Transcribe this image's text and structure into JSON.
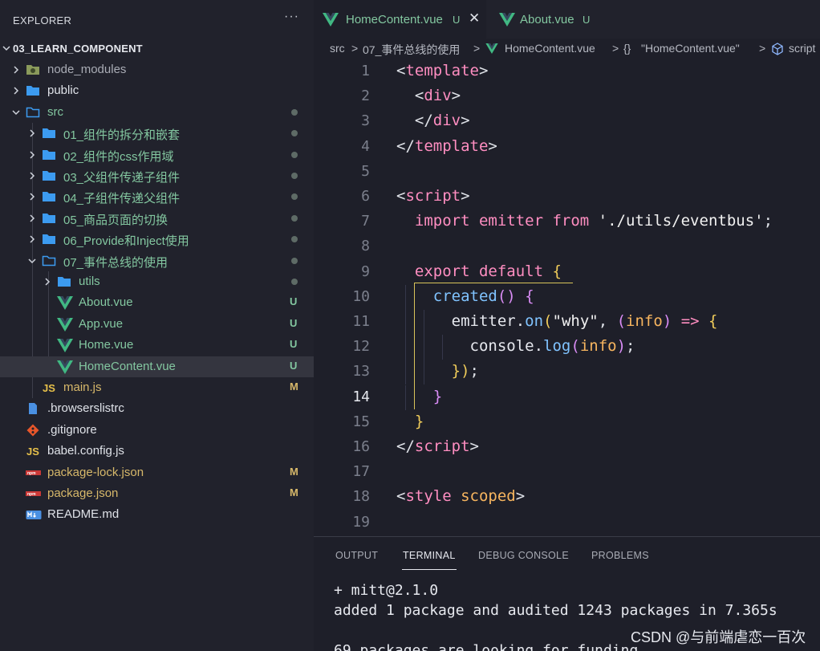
{
  "explorer": {
    "title": "EXPLORER",
    "more": "···",
    "project": "03_LEARN_COMPONENT"
  },
  "tree": [
    {
      "label": "node_modules",
      "icon": "node-modules-folder-icon",
      "indent": 0,
      "chevron": "right",
      "color": "dim"
    },
    {
      "label": "public",
      "icon": "folder-icon",
      "indent": 0,
      "chevron": "right",
      "color": "white"
    },
    {
      "label": "src",
      "icon": "folder-open-icon",
      "indent": 0,
      "chevron": "down",
      "color": "green",
      "dot": true
    },
    {
      "label": "01_组件的拆分和嵌套",
      "icon": "folder-icon",
      "indent": 1,
      "chevron": "right",
      "color": "green",
      "dot": true
    },
    {
      "label": "02_组件的css作用域",
      "icon": "folder-icon",
      "indent": 1,
      "chevron": "right",
      "color": "green",
      "dot": true
    },
    {
      "label": "03_父组件传递子组件",
      "icon": "folder-icon",
      "indent": 1,
      "chevron": "right",
      "color": "green",
      "dot": true
    },
    {
      "label": "04_子组件传递父组件",
      "icon": "folder-icon",
      "indent": 1,
      "chevron": "right",
      "color": "green",
      "dot": true
    },
    {
      "label": "05_商品页面的切换",
      "icon": "folder-icon",
      "indent": 1,
      "chevron": "right",
      "color": "green",
      "dot": true
    },
    {
      "label": "06_Provide和Inject使用",
      "icon": "folder-icon",
      "indent": 1,
      "chevron": "right",
      "color": "green",
      "dot": true
    },
    {
      "label": "07_事件总线的使用",
      "icon": "folder-open-icon",
      "indent": 1,
      "chevron": "down",
      "color": "green",
      "dot": true
    },
    {
      "label": "utils",
      "icon": "folder-icon",
      "indent": 2,
      "chevron": "right",
      "color": "green",
      "dot": true
    },
    {
      "label": "About.vue",
      "icon": "vue-icon",
      "indent": 2,
      "color": "green",
      "badge": "U"
    },
    {
      "label": "App.vue",
      "icon": "vue-icon",
      "indent": 2,
      "color": "green",
      "badge": "U"
    },
    {
      "label": "Home.vue",
      "icon": "vue-icon",
      "indent": 2,
      "color": "green",
      "badge": "U"
    },
    {
      "label": "HomeContent.vue",
      "icon": "vue-icon",
      "indent": 2,
      "color": "green",
      "badge": "U",
      "selected": true
    },
    {
      "label": "main.js",
      "icon": "js-icon",
      "indent": 1,
      "color": "yellow",
      "badge": "M"
    },
    {
      "label": ".browserslistrc",
      "icon": "file-icon",
      "indent": 0,
      "color": "white"
    },
    {
      "label": ".gitignore",
      "icon": "git-icon",
      "indent": 0,
      "color": "white"
    },
    {
      "label": "babel.config.js",
      "icon": "js-icon",
      "indent": 0,
      "color": "white"
    },
    {
      "label": "package-lock.json",
      "icon": "npm-icon",
      "indent": 0,
      "color": "yellow",
      "badge": "M"
    },
    {
      "label": "package.json",
      "icon": "npm-icon",
      "indent": 0,
      "color": "yellow",
      "badge": "M"
    },
    {
      "label": "README.md",
      "icon": "markdown-icon",
      "indent": 0,
      "color": "white"
    }
  ],
  "tabs": [
    {
      "name": "HomeContent.vue",
      "status": "U",
      "close": "✕",
      "active": true
    },
    {
      "name": "About.vue",
      "status": "U",
      "active": false
    }
  ],
  "breadcrumb": {
    "part1": "src",
    "sep": ">",
    "part2": "07_事件总线的使用",
    "part3": "HomeContent.vue",
    "part4_icon": "{}",
    "part4": "\"HomeContent.vue\"",
    "part5": "script"
  },
  "code": [
    {
      "n": "1",
      "tokens": [
        [
          "punc",
          "<"
        ],
        [
          "tag",
          "template"
        ],
        [
          "punc",
          ">"
        ]
      ]
    },
    {
      "n": "2",
      "tokens": [
        [
          "punc",
          "  <"
        ],
        [
          "tag",
          "div"
        ],
        [
          "punc",
          ">"
        ]
      ]
    },
    {
      "n": "3",
      "tokens": [
        [
          "punc",
          "  </"
        ],
        [
          "tag",
          "div"
        ],
        [
          "punc",
          ">"
        ]
      ]
    },
    {
      "n": "4",
      "tokens": [
        [
          "punc",
          "</"
        ],
        [
          "tag",
          "template"
        ],
        [
          "punc",
          ">"
        ]
      ]
    },
    {
      "n": "5",
      "tokens": []
    },
    {
      "n": "6",
      "tokens": [
        [
          "punc",
          "<"
        ],
        [
          "tag",
          "script"
        ],
        [
          "punc",
          ">"
        ]
      ]
    },
    {
      "n": "7",
      "tokens": [
        [
          "kw",
          "  import "
        ],
        [
          "kw",
          "emitter "
        ],
        [
          "kw",
          "from "
        ],
        [
          "str",
          "'./utils/eventbus'"
        ],
        [
          "punc",
          ";"
        ]
      ]
    },
    {
      "n": "8",
      "tokens": []
    },
    {
      "n": "9",
      "tokens": [
        [
          "kw",
          "  export "
        ],
        [
          "kw",
          "default "
        ],
        [
          "par",
          "{"
        ]
      ]
    },
    {
      "n": "10",
      "tokens": [
        [
          "fn",
          "    created"
        ],
        [
          "par2",
          "()"
        ],
        [
          "punc",
          " "
        ],
        [
          "par2",
          "{"
        ]
      ]
    },
    {
      "n": "11",
      "tokens": [
        [
          "id",
          "      emitter."
        ],
        [
          "fn",
          "on"
        ],
        [
          "par",
          "("
        ],
        [
          "str",
          "\"why\""
        ],
        [
          "punc",
          ", "
        ],
        [
          "par2",
          "("
        ],
        [
          "param",
          "info"
        ],
        [
          "par2",
          ")"
        ],
        [
          "kw",
          " => "
        ],
        [
          "par",
          "{"
        ]
      ]
    },
    {
      "n": "12",
      "tokens": [
        [
          "id",
          "        console."
        ],
        [
          "fn",
          "log"
        ],
        [
          "par2",
          "("
        ],
        [
          "param",
          "info"
        ],
        [
          "par2",
          ")"
        ],
        [
          "punc",
          ";"
        ]
      ]
    },
    {
      "n": "13",
      "tokens": [
        [
          "par",
          "      }"
        ],
        [
          "par",
          ")"
        ],
        [
          "punc",
          ";"
        ]
      ]
    },
    {
      "n": "14",
      "tokens": [
        [
          "par2",
          "    }"
        ]
      ],
      "current": true
    },
    {
      "n": "15",
      "tokens": [
        [
          "par",
          "  }"
        ]
      ]
    },
    {
      "n": "16",
      "tokens": [
        [
          "punc",
          "</"
        ],
        [
          "tag",
          "script"
        ],
        [
          "punc",
          ">"
        ]
      ]
    },
    {
      "n": "17",
      "tokens": []
    },
    {
      "n": "18",
      "tokens": [
        [
          "punc",
          "<"
        ],
        [
          "tag",
          "style "
        ],
        [
          "attr",
          "scoped"
        ],
        [
          "punc",
          ">"
        ]
      ]
    },
    {
      "n": "19",
      "tokens": []
    }
  ],
  "panel": {
    "tabs": [
      "OUTPUT",
      "TERMINAL",
      "DEBUG CONSOLE",
      "PROBLEMS"
    ],
    "active_tab": "TERMINAL",
    "lines": [
      "+ mitt@2.1.0",
      "added 1 package and audited 1243 packages in 7.365s",
      "",
      "69 packages are looking for funding"
    ]
  },
  "watermark": "CSDN @与前端虐恋一百次",
  "colors": {
    "sidebar_bg": "#21222c",
    "editor_bg": "#1e1f29",
    "git_untracked": "#83c7a0",
    "git_modified": "#d7b86a",
    "folder": "#3c9bf0"
  }
}
